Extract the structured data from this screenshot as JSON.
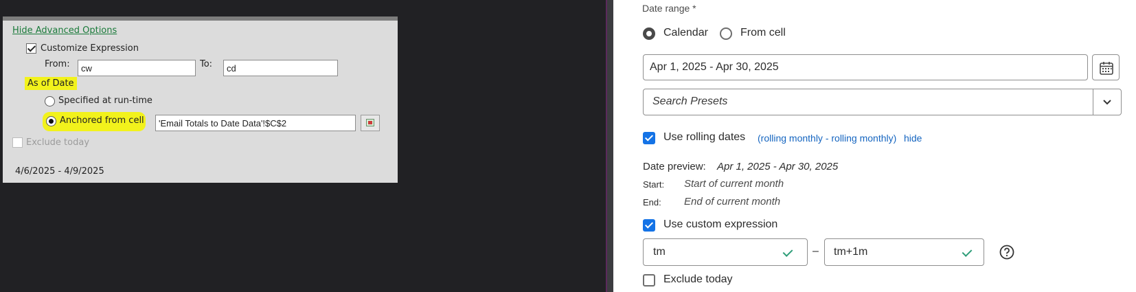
{
  "legacy_dialog": {
    "hide_advanced_link": "Hide Advanced Options",
    "customize_expression_label": "Customize Expression",
    "customize_expression_checked": true,
    "from_label": "From:",
    "from_value": "cw",
    "to_label": "To:",
    "to_value": "cd",
    "as_of_date_label": "As of Date",
    "radio_specified_label": "Specified at run-time",
    "radio_anchored_label": "Anchored  from cell",
    "selected_radio": "anchored",
    "anchor_cell_value": "'Email Totals to Date Data'!$C$2",
    "exclude_today_label": "Exclude today",
    "exclude_today_checked": false,
    "date_range_display": "4/6/2025 - 4/9/2025",
    "highlight_color": "#f2f21c"
  },
  "panel": {
    "date_range_label": "Date range *",
    "radio_calendar_label": "Calendar",
    "radio_from_cell_label": "From cell",
    "selected_radio": "calendar",
    "date_range_value": "Apr 1, 2025 - Apr 30, 2025",
    "calendar_button_icon": "calendar-icon",
    "search_presets_placeholder": "Search Presets",
    "use_rolling_dates_label": "Use rolling dates",
    "use_rolling_dates_checked": true,
    "rolling_summary": "(rolling monthly - rolling monthly)",
    "hide_link": "hide",
    "date_preview_label": "Date preview:",
    "date_preview_value": "Apr 1, 2025 - Apr 30, 2025",
    "start_label": "Start:",
    "start_value": "Start of current month",
    "end_label": "End:",
    "end_value": "End of current month",
    "use_custom_expression_label": "Use custom expression",
    "use_custom_expression_checked": true,
    "expr_from_value": "tm",
    "expr_separator": "–",
    "expr_to_value": "tm+1m",
    "help_icon": "help-icon",
    "exclude_today_label": "Exclude today",
    "exclude_today_checked": false,
    "accent_color": "#1473e6",
    "valid_color": "#2d9d78"
  }
}
